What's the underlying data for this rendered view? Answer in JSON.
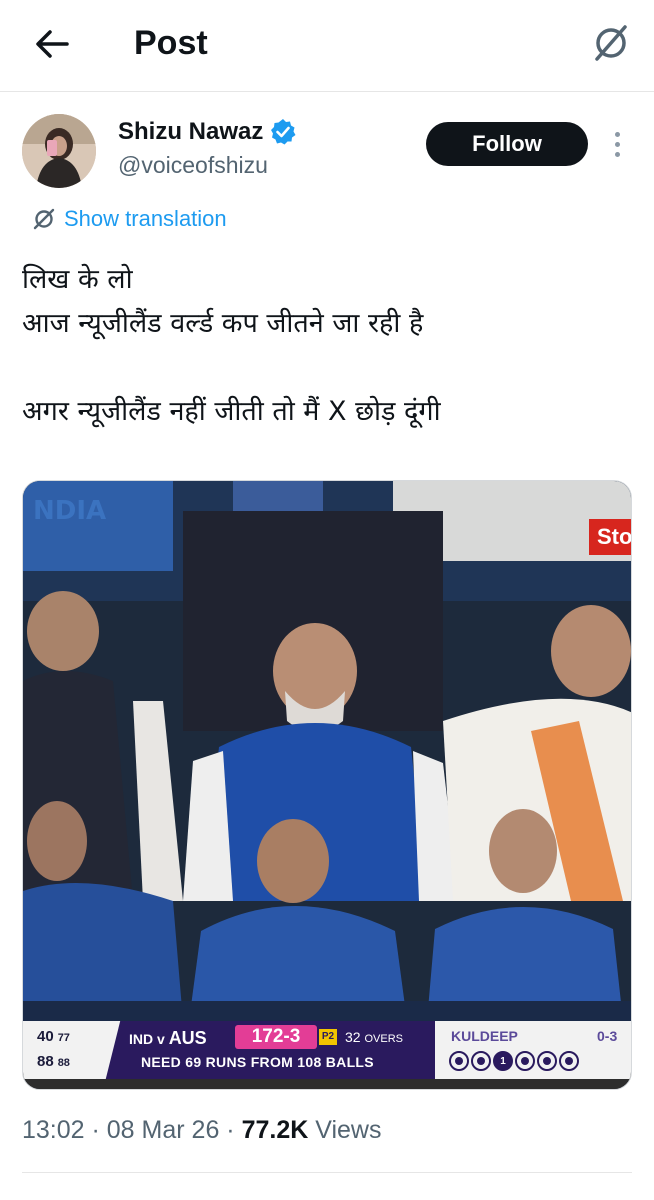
{
  "header": {
    "title": "Post",
    "back_icon": "arrow-left-icon",
    "grok_icon": "grok-icon"
  },
  "author": {
    "display_name": "Shizu Nawaz",
    "handle": "@voiceofshizu",
    "verified": true,
    "verified_color": "#1d9bf0"
  },
  "actions": {
    "follow_label": "Follow",
    "more_icon": "more-vertical-icon"
  },
  "translation": {
    "label": "Show translation",
    "icon": "grok-icon",
    "color": "#1d9bf0"
  },
  "tweet": {
    "lines": [
      "लिख के लो",
      "आज न्यूजीलैंड वर्ल्ड कप जीतने जा रही है",
      "",
      "अगर न्यूजीलैंड नहीं जीती तो मैं X छोड़ दूंगी"
    ]
  },
  "media": {
    "stamp_text": "Sto",
    "scorebar": {
      "left_row1_runs": "40",
      "left_row1_balls": "77",
      "left_row2_runs": "88",
      "left_row2_balls": "88",
      "teams_small": "IND v",
      "teams_big": "AUS",
      "score": "172-3",
      "powerplay": "P2",
      "overs_value": "32",
      "overs_label": "OVERS",
      "need": "NEED 69 RUNS FROM 108 BALLS",
      "bowler": "KULDEEP",
      "bowler_figures": "0-3",
      "balls": [
        "dot",
        "dot",
        "1",
        "dot",
        "dot",
        "dot"
      ]
    }
  },
  "meta": {
    "time": "13:02",
    "separator": " · ",
    "date": "08 Mar 26",
    "views_count": "77.2K",
    "views_label": "Views"
  }
}
